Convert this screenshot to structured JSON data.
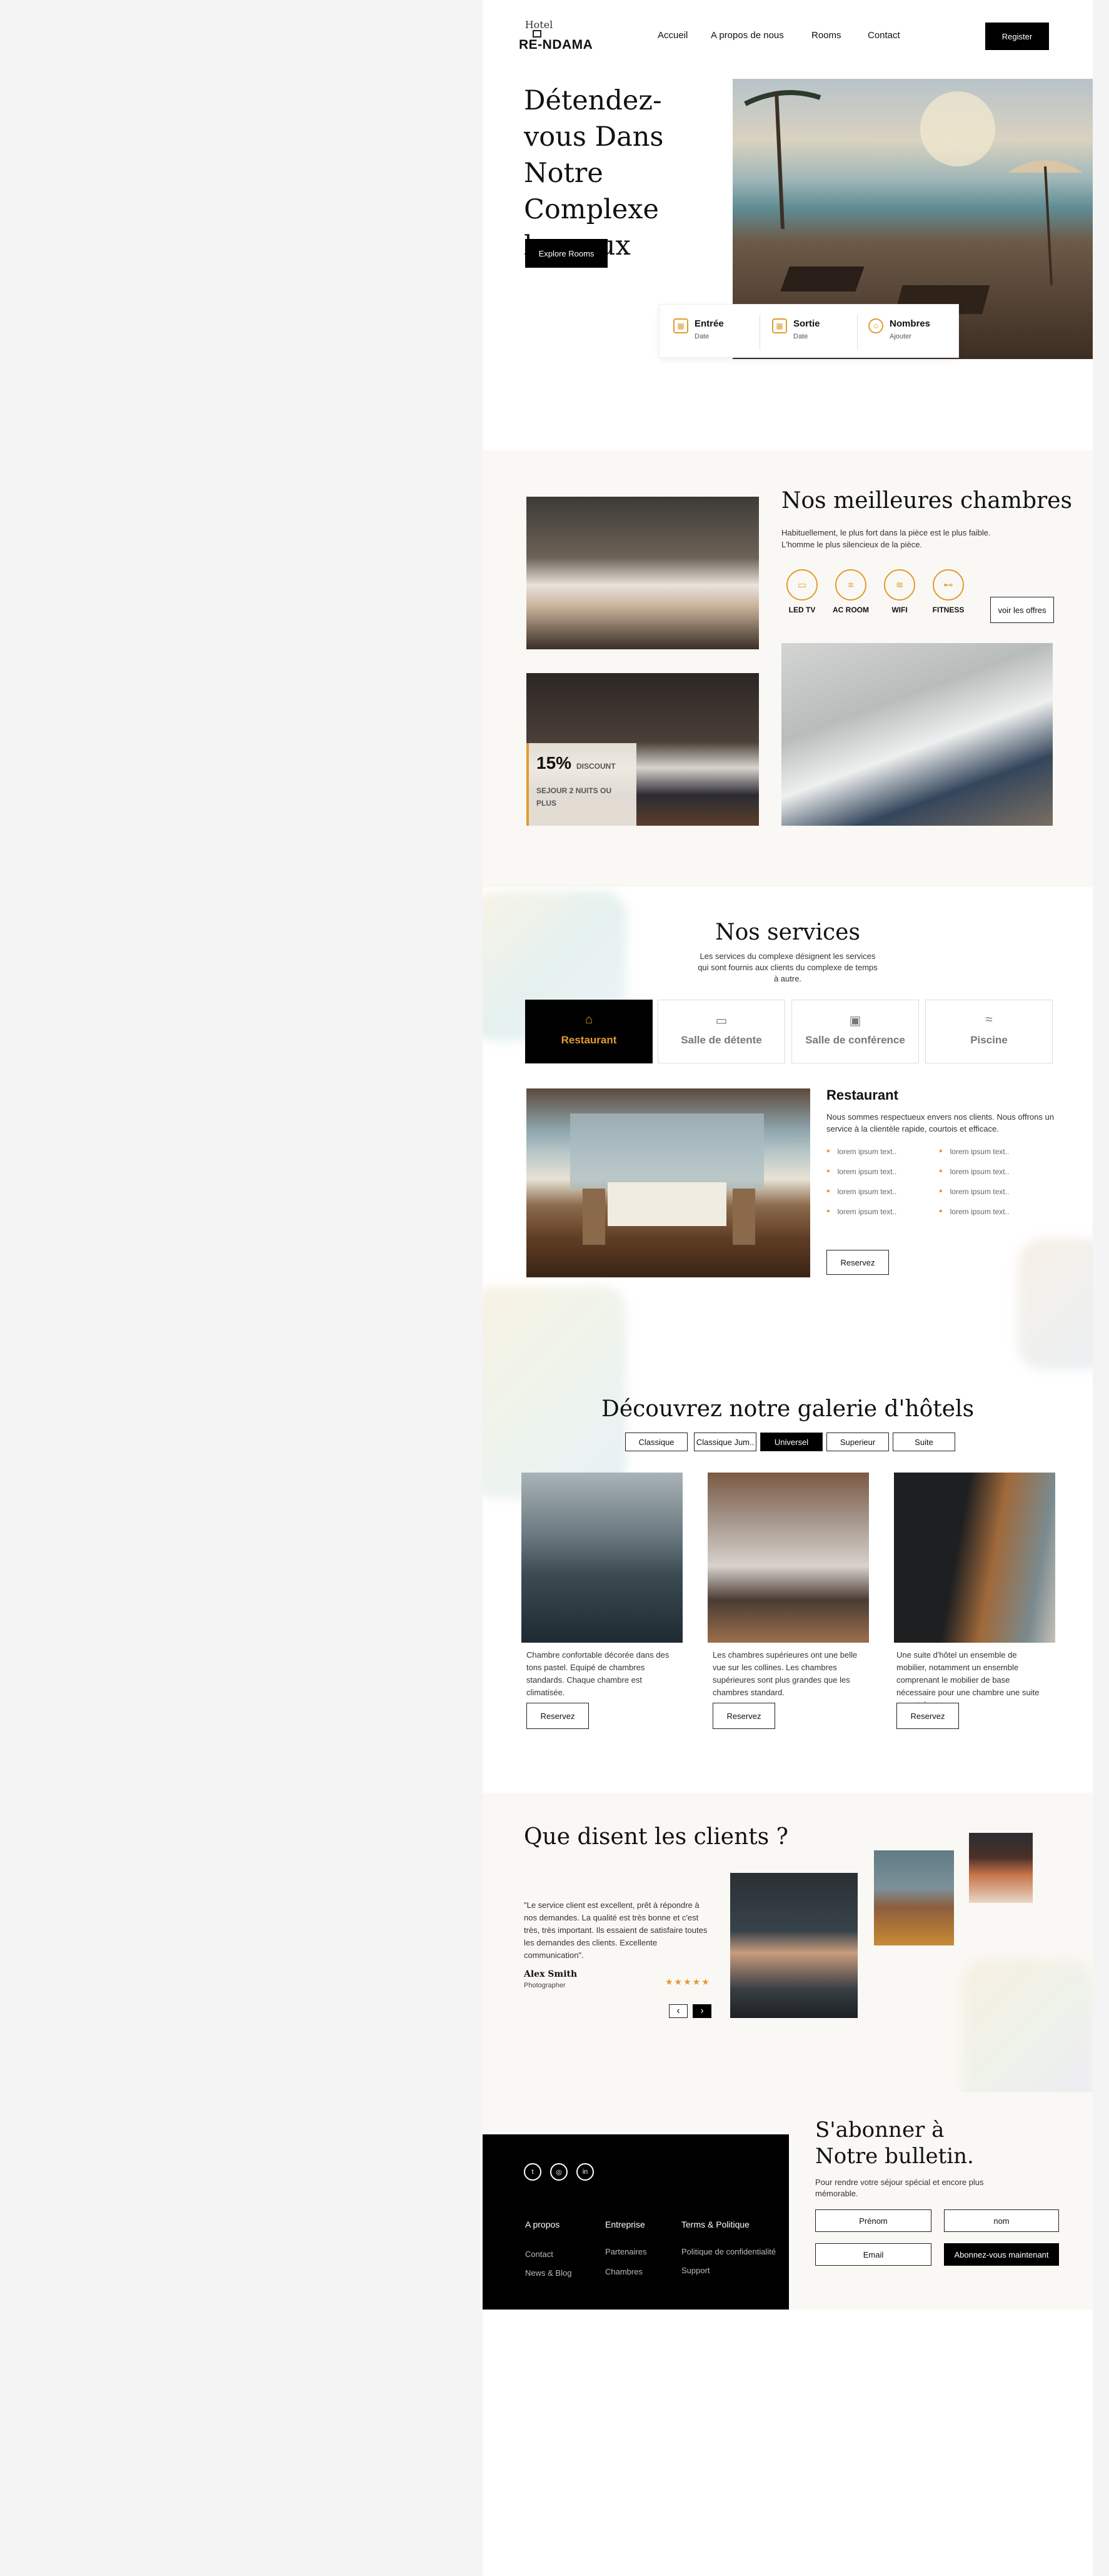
{
  "brand": {
    "top": "Hotel",
    "name": "RE-NDAMA"
  },
  "nav": {
    "items": [
      "Accueil",
      "A propos de nous",
      "Rooms",
      "Contact"
    ],
    "register": "Register"
  },
  "hero": {
    "title": "Détendez-vous Dans Notre Complexe luxueux",
    "cta": "Explore Rooms",
    "booking": [
      {
        "icon": "calendar-icon",
        "label": "Entrée",
        "sub": "Date"
      },
      {
        "icon": "calendar-icon",
        "label": "Sortie",
        "sub": "Date"
      },
      {
        "icon": "user-icon",
        "label": "Nombres",
        "sub": "Ajouter"
      }
    ]
  },
  "rooms": {
    "title": "Nos meilleures chambres",
    "desc": "Habituellement, le plus fort dans la pièce est le plus faible. L'homme le plus silencieux de la pièce.",
    "amenities": [
      "LED TV",
      "AC ROOM",
      "WIFI",
      "FITNESS"
    ],
    "offers_button": "voir les offres",
    "discount": {
      "percent": "15%",
      "label": "DISCOUNT",
      "sub": "SEJOUR 2 NUITS OU PLUS"
    }
  },
  "services": {
    "title": "Nos services",
    "desc": "Les services du complexe désignent les services qui sont fournis aux clients du complexe de temps à autre.",
    "tabs": [
      "Restaurant",
      "Salle de détente",
      "Salle de conférence",
      "Piscine"
    ],
    "restaurant": {
      "title": "Restaurant",
      "desc": "Nous sommes respectueux envers nos clients. Nous offrons un service à la clientèle rapide, courtois et efficace.",
      "items": [
        "lorem ipsum text..",
        "lorem ipsum text..",
        "lorem ipsum text..",
        "lorem ipsum text..",
        "lorem ipsum text..",
        "lorem ipsum text..",
        "lorem ipsum text..",
        "lorem ipsum text.."
      ],
      "button": "Reservez"
    }
  },
  "gallery": {
    "title": "Découvrez notre galerie d'hôtels",
    "tabs": [
      "Classique",
      "Classique Jum..",
      "Universel",
      "Superieur",
      "Suite"
    ],
    "active_tab": "Universel",
    "items": [
      {
        "text": "Chambre confortable décorée dans des tons pastel. Equipé de chambres standards. Chaque chambre est climatisée.",
        "button": "Reservez"
      },
      {
        "text": "Les chambres supérieures ont une belle vue sur les collines. Les chambres supérieures sont plus grandes que les chambres standard.",
        "button": "Reservez"
      },
      {
        "text": "Une suite d'hôtel un ensemble de mobilier, notamment un ensemble comprenant le mobilier de base nécessaire pour une chambre une suite parentale.",
        "button": "Reservez"
      }
    ]
  },
  "testimonials": {
    "title": "Que disent les clients ?",
    "quote": "\"Le service client est excellent, prêt à répondre à nos demandes. La qualité est très bonne et c'est très, très important. Ils essaient de satisfaire toutes les demandes des clients. Excellente communication\".",
    "author": "Alex Smith",
    "role": "Photographer",
    "stars": "★★★★★",
    "prev": "‹",
    "next": "›"
  },
  "footer": {
    "social": [
      "twitter-icon",
      "instagram-icon",
      "linkedin-icon"
    ],
    "cols": [
      {
        "title": "A propos",
        "links": [
          "Contact",
          "News & Blog"
        ]
      },
      {
        "title": "Entreprise",
        "links": [
          "Partenaires",
          "Chambres"
        ]
      },
      {
        "title": "Terms & Politique",
        "links": [
          "Politique de confidentialité",
          "Support"
        ]
      }
    ]
  },
  "newsletter": {
    "title": "S'abonner à Notre bulletin.",
    "desc": "Pour rendre votre séjour spécial et encore plus mémorable.",
    "first_name": "Prénom",
    "last_name": "nom",
    "email": "Email",
    "button": "Abonnez-vous maintenant"
  },
  "colors": {
    "accent": "#e39a2f",
    "dark": "#000000",
    "cream": "#faf8f4"
  }
}
